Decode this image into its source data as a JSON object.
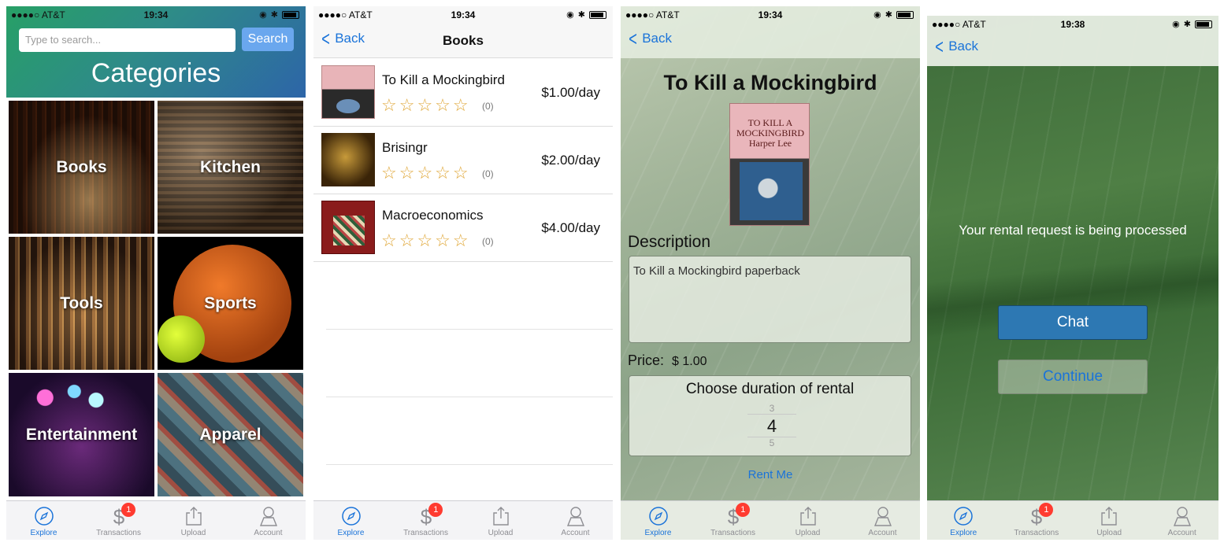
{
  "status": {
    "carrier": "●●●●○ AT&T",
    "time_a": "19:34",
    "time_b": "19:38"
  },
  "tabbar": {
    "explore": "Explore",
    "transactions": "Transactions",
    "transactions_badge": "1",
    "upload": "Upload",
    "account": "Account"
  },
  "nav": {
    "back": "Back",
    "books_title": "Books"
  },
  "categories_screen": {
    "search_placeholder": "Type to search...",
    "search_button": "Search",
    "title": "Categories",
    "tiles": [
      "Books",
      "Kitchen",
      "Tools",
      "Sports",
      "Entertainment",
      "Apparel"
    ]
  },
  "books_screen": {
    "items": [
      {
        "title": "To Kill a Mockingbird",
        "stars": "☆☆☆☆☆",
        "count": "(0)",
        "price": "$1.00/day"
      },
      {
        "title": "Brisingr",
        "stars": "☆☆☆☆☆",
        "count": "(0)",
        "price": "$2.00/day"
      },
      {
        "title": "Macroeconomics",
        "stars": "☆☆☆☆☆",
        "count": "(0)",
        "price": "$4.00/day"
      }
    ]
  },
  "detail_screen": {
    "title": "To Kill a Mockingbird",
    "cover_text": "TO KILL A MOCKINGBIRD Harper Lee",
    "description_label": "Description",
    "description": "To Kill a Mockingbird paperback",
    "price_label": "Price:",
    "price_value": "$ 1.00",
    "duration_title": "Choose duration of rental",
    "picker_prev": "3",
    "picker_selected": "4",
    "picker_next": "5",
    "rent_button": "Rent Me"
  },
  "confirm_screen": {
    "message": "Your rental request is being processed",
    "chat_button": "Chat",
    "continue_button": "Continue"
  },
  "colors": {
    "ios_blue": "#1a73d9",
    "badge_red": "#ff3b30",
    "chat_button": "#2d78b3",
    "search_button": "#6aa7ee"
  },
  "icons": {
    "explore": "compass-icon",
    "transactions": "dollar-icon",
    "upload": "share-upload-icon",
    "account": "person-icon",
    "back": "chevron-left-icon"
  }
}
